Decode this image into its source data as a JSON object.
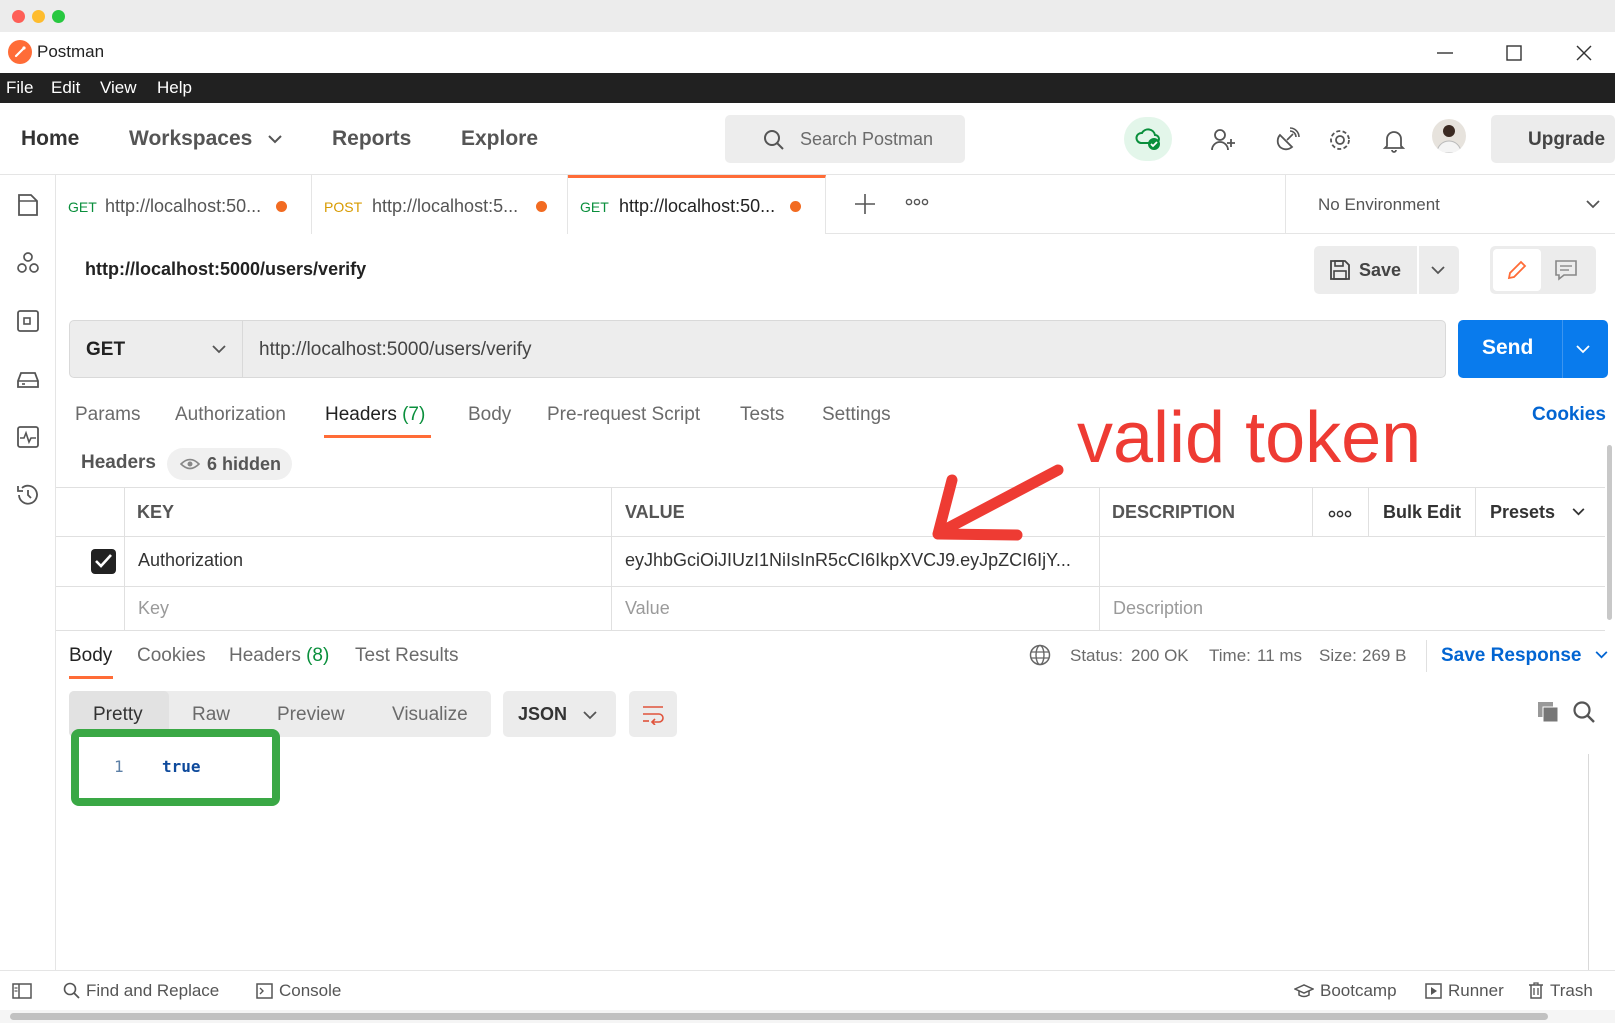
{
  "window": {
    "app_title": "Postman"
  },
  "menu": [
    "File",
    "Edit",
    "View",
    "Help"
  ],
  "header": {
    "nav": {
      "home": "Home",
      "workspaces": "Workspaces",
      "reports": "Reports",
      "explore": "Explore"
    },
    "search_placeholder": "Search Postman",
    "upgrade_label": "Upgrade"
  },
  "tabs": [
    {
      "method": "GET",
      "url": "http://localhost:50..."
    },
    {
      "method": "POST",
      "url": "http://localhost:5..."
    },
    {
      "method": "GET",
      "url": "http://localhost:50..."
    }
  ],
  "environment": "No Environment",
  "request": {
    "title": "http://localhost:5000/users/verify",
    "save_label": "Save",
    "method": "GET",
    "url": "http://localhost:5000/users/verify",
    "send_label": "Send",
    "subtabs": {
      "params": "Params",
      "authorization": "Authorization",
      "headers": "Headers",
      "headers_count": "(7)",
      "body": "Body",
      "prerequest": "Pre-request Script",
      "tests": "Tests",
      "settings": "Settings"
    },
    "cookies_label": "Cookies"
  },
  "headers_section": {
    "label": "Headers",
    "hidden_label": "6 hidden",
    "columns": {
      "key": "KEY",
      "value": "VALUE",
      "description": "DESCRIPTION"
    },
    "bulk_edit": "Bulk Edit",
    "presets": "Presets",
    "rows": [
      {
        "checked": true,
        "key": "Authorization",
        "value": "eyJhbGciOiJIUzI1NiIsInR5cCI6IkpXVCJ9.eyJpZCI6IjY..."
      }
    ],
    "placeholder": {
      "key": "Key",
      "value": "Value",
      "description": "Description"
    }
  },
  "annotation": {
    "text": "valid token",
    "color": "#ee3b33",
    "highlight_color": "#3aa845"
  },
  "response": {
    "tabs": {
      "body": "Body",
      "cookies": "Cookies",
      "headers": "Headers",
      "headers_count": "(8)",
      "test_results": "Test Results"
    },
    "status_label": "Status:",
    "status_value": "200 OK",
    "time_label": "Time:",
    "time_value": "11 ms",
    "size_label": "Size:",
    "size_value": "269 B",
    "save_response": "Save Response",
    "views": [
      "Pretty",
      "Raw",
      "Preview",
      "Visualize"
    ],
    "format": "JSON",
    "body_lines": [
      {
        "line": "1",
        "text": "true"
      }
    ]
  },
  "footer": {
    "find_replace": "Find and Replace",
    "console": "Console",
    "bootcamp": "Bootcamp",
    "runner": "Runner",
    "trash": "Trash"
  },
  "colors": {
    "accent": "#ff6c37",
    "send_blue": "#097bed",
    "link_blue": "#0265d2",
    "success_green": "#0a8f3c",
    "post_orange": "#d89b00"
  }
}
